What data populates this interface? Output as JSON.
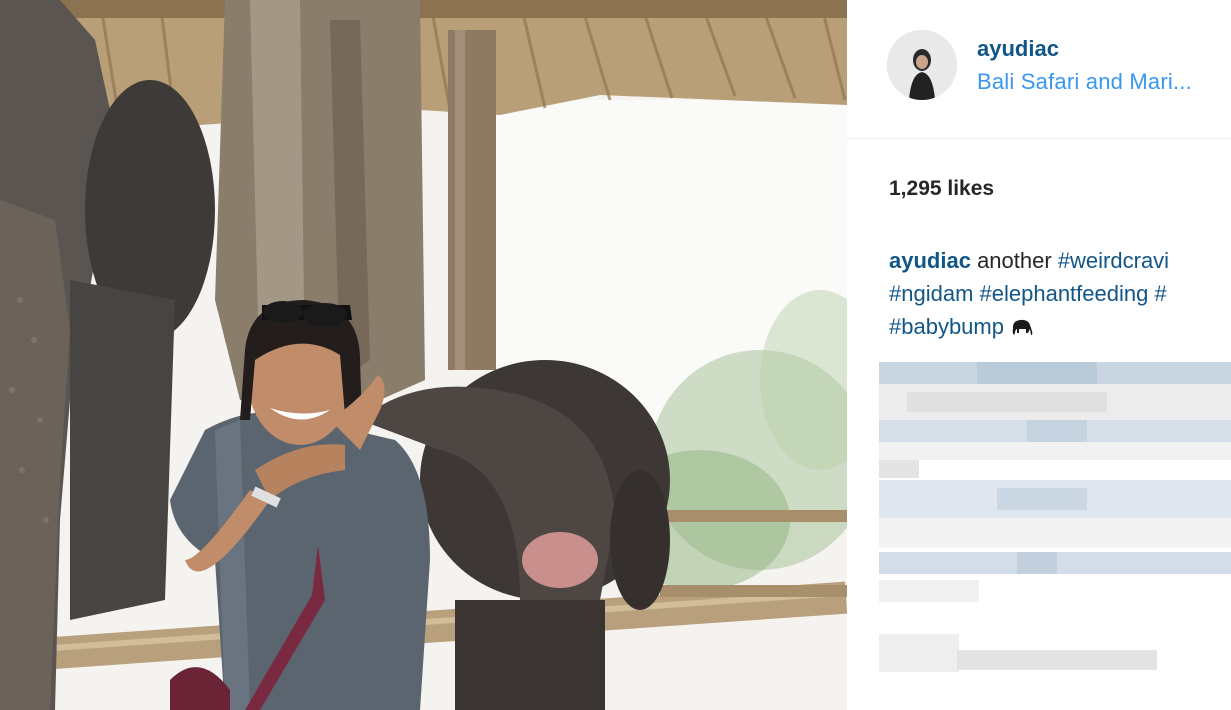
{
  "post": {
    "username": "ayudiac",
    "location": "Bali Safari and Mari...",
    "likes": "1,295 likes",
    "caption": {
      "user": "ayudiac",
      "text": "another",
      "tags": [
        "#weirdcravi",
        "#ngidam",
        "#elephantfeeding",
        "#",
        "#babybump"
      ]
    },
    "emoji_icon": "elephant-emoji",
    "photo_description_icon": "photo-image",
    "colors": {
      "username": "#125688",
      "location": "#3897f0",
      "text": "#262626",
      "divider": "#efefef"
    }
  }
}
